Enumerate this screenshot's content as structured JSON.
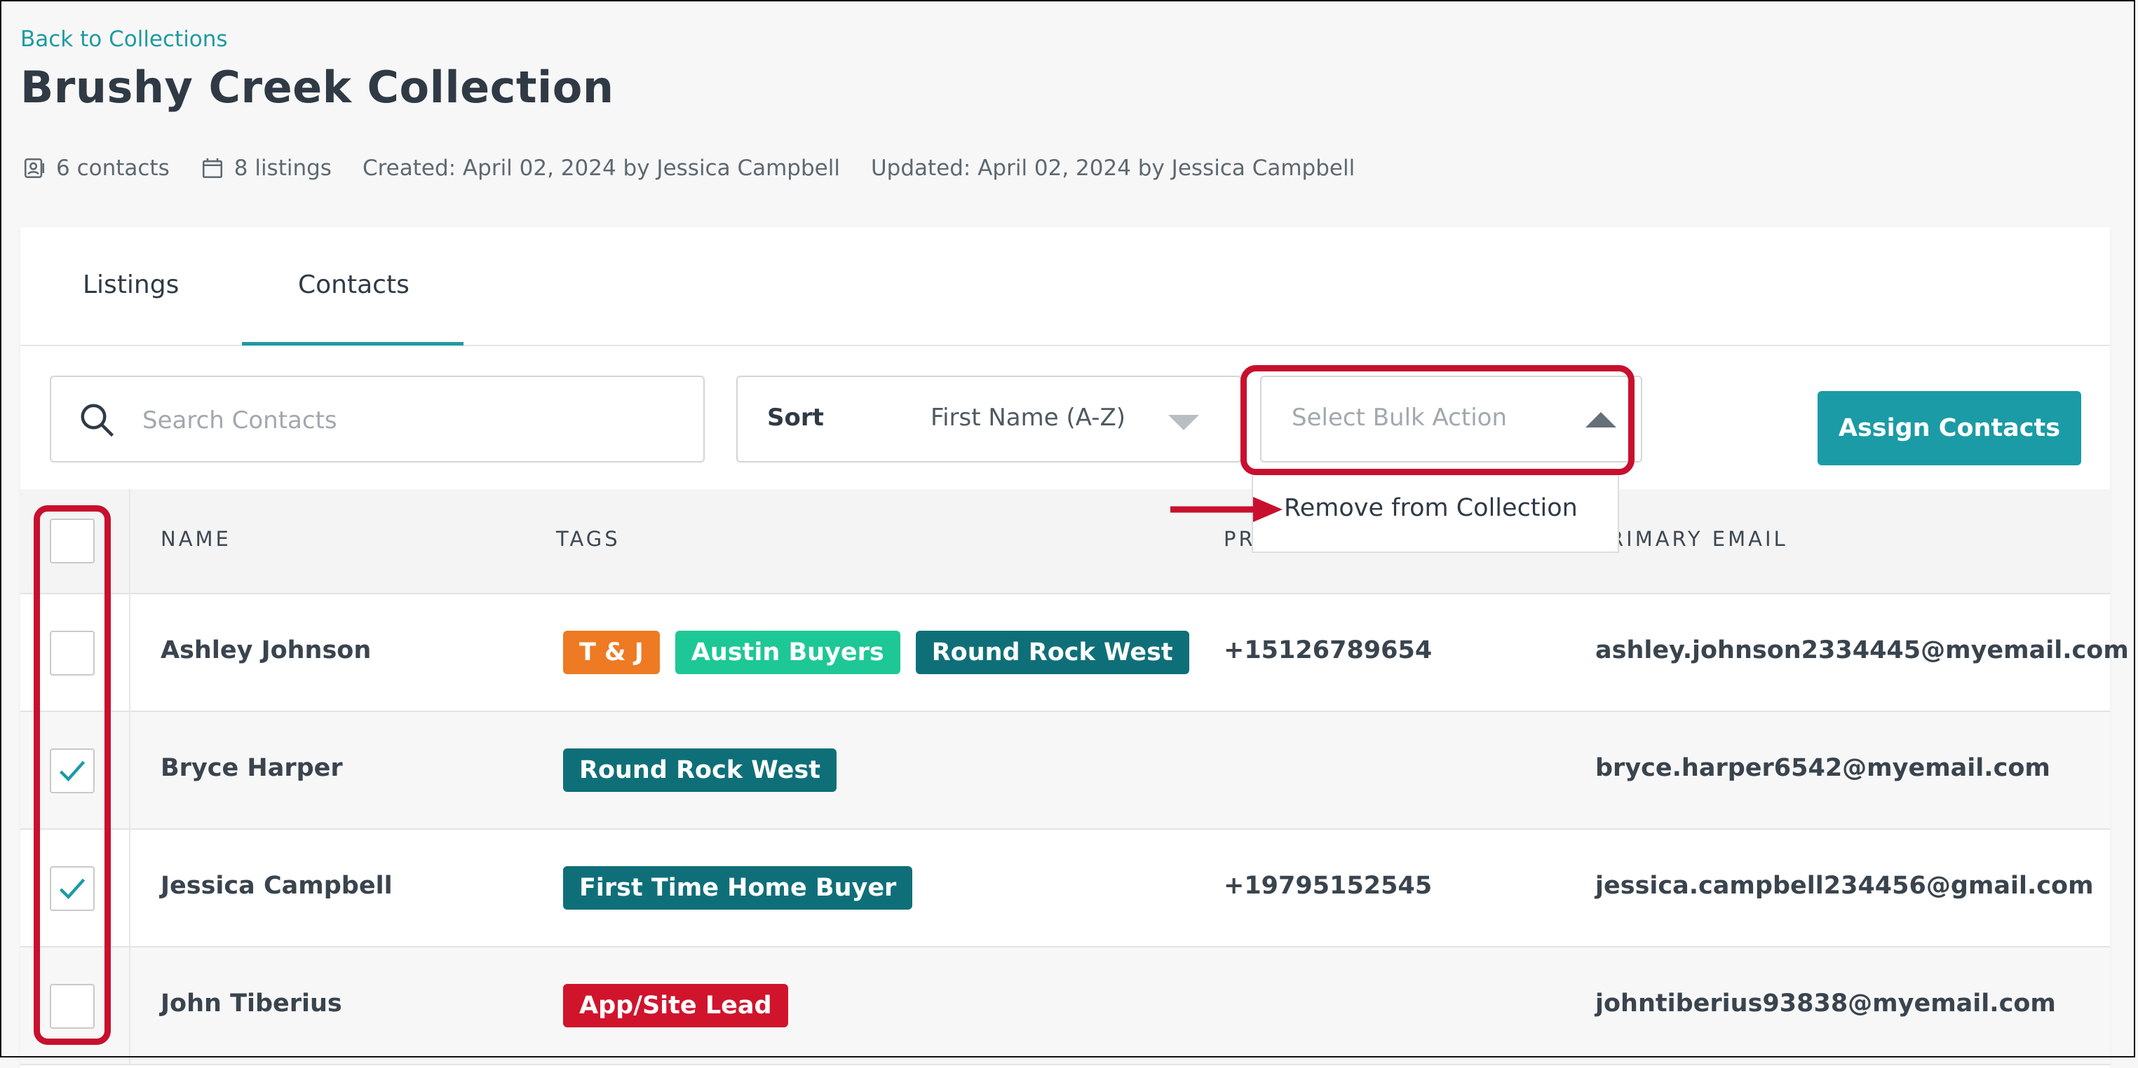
{
  "header": {
    "back_link": "Back to Collections",
    "title": "Brushy Creek Collection",
    "meta": {
      "contacts": "6 contacts",
      "listings": "8 listings",
      "created": "Created: April 02, 2024 by Jessica Campbell",
      "updated": "Updated: April 02, 2024 by Jessica Campbell"
    }
  },
  "tabs": [
    {
      "label": "Listings",
      "active": false
    },
    {
      "label": "Contacts",
      "active": true
    }
  ],
  "toolbar": {
    "search_placeholder": "Search Contacts",
    "search_value": "",
    "sort_label": "Sort",
    "sort_value": "First Name (A-Z)",
    "bulk_placeholder": "Select Bulk Action",
    "bulk_options": [
      "Remove from Collection"
    ],
    "assign_label": "Assign Contacts"
  },
  "table": {
    "headers": {
      "name": "NAME",
      "tags": "TAGS",
      "phone": "PR",
      "email": "RIMARY EMAIL"
    },
    "header_checkbox_checked": false,
    "rows": [
      {
        "name": "Ashley Johnson",
        "tags": [
          "T & J",
          "Austin Buyers",
          "Round Rock West"
        ],
        "phone": "+15126789654",
        "email": "ashley.johnson2334445@myemail.com",
        "checked": false
      },
      {
        "name": "Bryce Harper",
        "tags": [
          "Round Rock West"
        ],
        "phone": "",
        "email": "bryce.harper6542@myemail.com",
        "checked": true
      },
      {
        "name": "Jessica Campbell",
        "tags": [
          "First Time Home Buyer"
        ],
        "phone": "+19795152545",
        "email": "jessica.campbell234456@gmail.com",
        "checked": true
      },
      {
        "name": "John Tiberius",
        "tags": [
          "App/Site Lead"
        ],
        "phone": "",
        "email": "johntiberius93838@myemail.com",
        "checked": false
      }
    ]
  },
  "colors": {
    "accent": "#1b9ba5",
    "highlight": "#c8102e",
    "tag_orange": "#ee7a23",
    "tag_green": "#1ec796",
    "tag_teal": "#0f6f78",
    "tag_red": "#d0142c"
  }
}
